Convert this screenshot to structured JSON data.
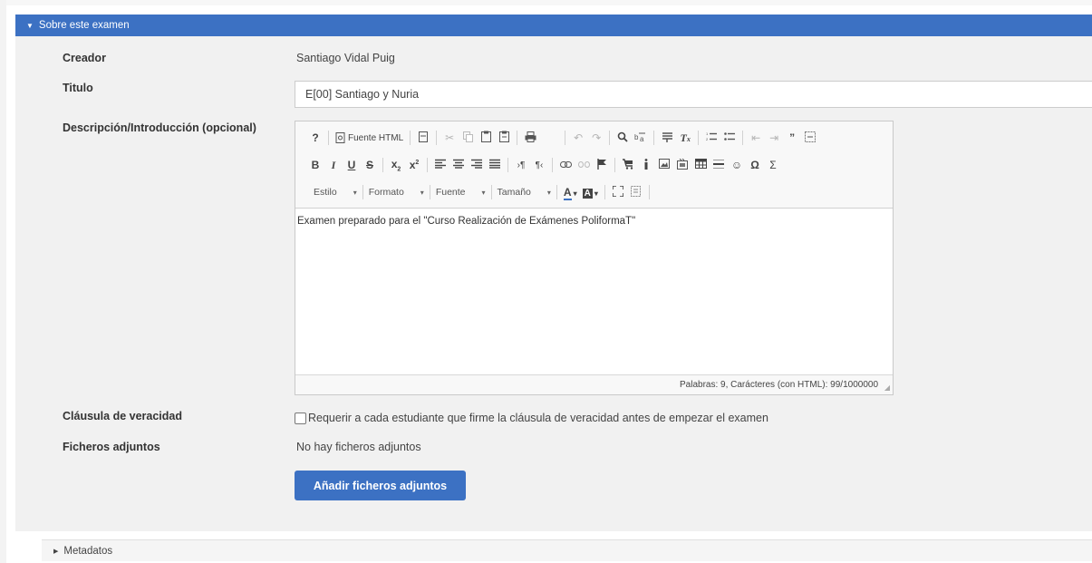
{
  "section": {
    "header": "Sobre este examen",
    "toggle_icon": "triangle-down-icon"
  },
  "fields": {
    "creador_label": "Creador",
    "creador_value": "Santiago Vidal Puig",
    "titulo_label": "Titulo",
    "titulo_value": "E[00]  Santiago y Nuria",
    "descripcion_label": "Descripción/Introducción (opcional)",
    "clausula_label": "Cláusula de veracidad",
    "clausula_checkbox_label": "Requerir a cada estudiante que firme la cláusula de veracidad antes de empezar el examen",
    "clausula_checked": false,
    "ficheros_label": "Ficheros adjuntos",
    "ficheros_value": "No hay ficheros adjuntos",
    "add_button_label": "Añadir ficheros adjuntos"
  },
  "editor": {
    "toolbar": {
      "help": "?",
      "source_html": "Fuente HTML",
      "bold": "B",
      "italic": "I",
      "underline": "U",
      "strike": "S",
      "subscript_base": "x",
      "subscript_mark": "2",
      "superscript_base": "x",
      "superscript_mark": "2",
      "omega": "Ω",
      "sigma": "Σ",
      "quote": "”",
      "styles": [
        "Estilo",
        "Formato",
        "Fuente",
        "Tamaño"
      ],
      "text_color": "A",
      "bg_color": "A"
    },
    "content": "Examen preparado para el \"Curso Realización de Exámenes PoliformaT\"",
    "status": "Palabras: 9, Carácteres (con HTML): 99/1000000"
  },
  "metadata": {
    "header": "Metadatos",
    "toggle_icon": "triangle-right-icon"
  },
  "colors": {
    "accent": "#3c71c3",
    "section_bg": "#f1f1f1"
  }
}
